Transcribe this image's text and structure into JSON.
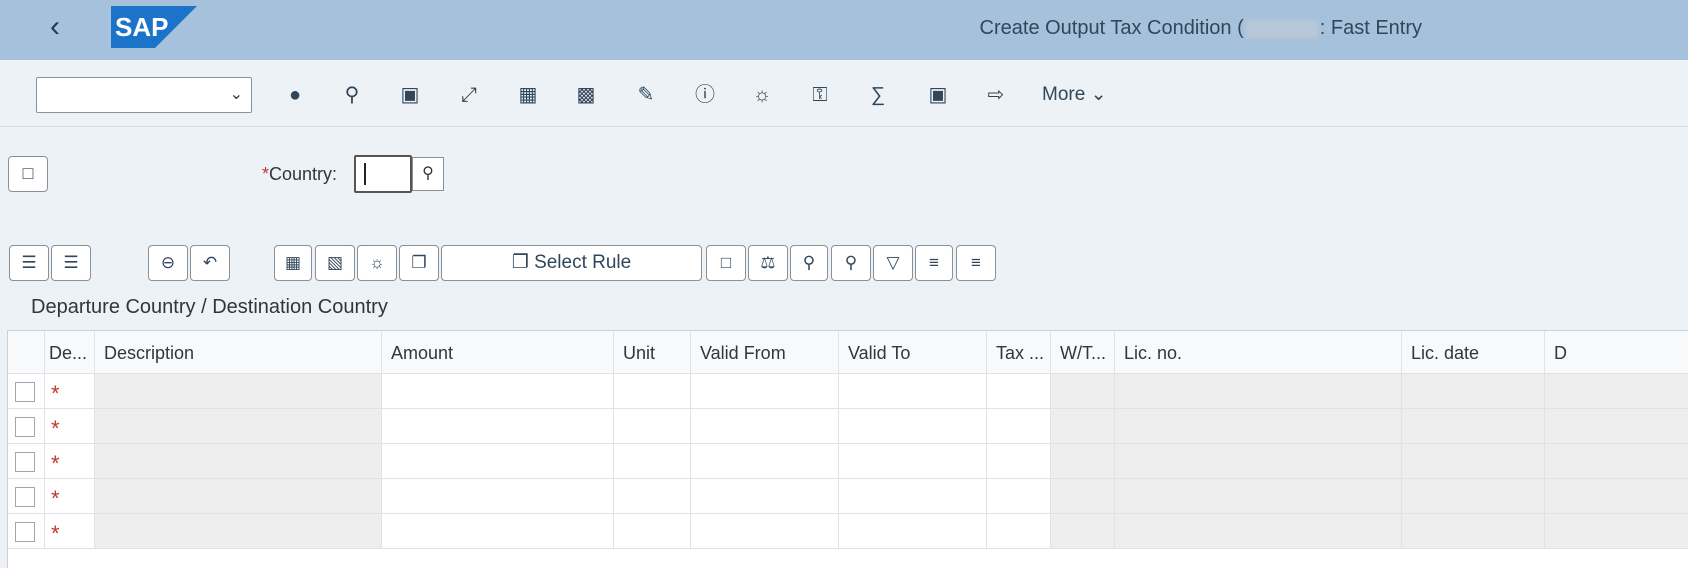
{
  "header": {
    "title_prefix": "Create Output Tax Condition (",
    "title_suffix": ": Fast Entry",
    "logo_text": "SAP"
  },
  "toolbar": {
    "command_field_value": "",
    "more_label": "More"
  },
  "selection": {
    "country_label": "Country:",
    "country_value": "",
    "required_marker": "*"
  },
  "table_toolbar": {
    "select_rule_label": "Select Rule"
  },
  "section": {
    "title": "Departure Country / Destination Country"
  },
  "table": {
    "columns": [
      "De...",
      "Description",
      "Amount",
      "Unit",
      "Valid From",
      "Valid To",
      "Tax ...",
      "W/T...",
      "Lic. no.",
      "Lic. date",
      "D"
    ],
    "row_marker": "*",
    "row_count": 5
  }
}
